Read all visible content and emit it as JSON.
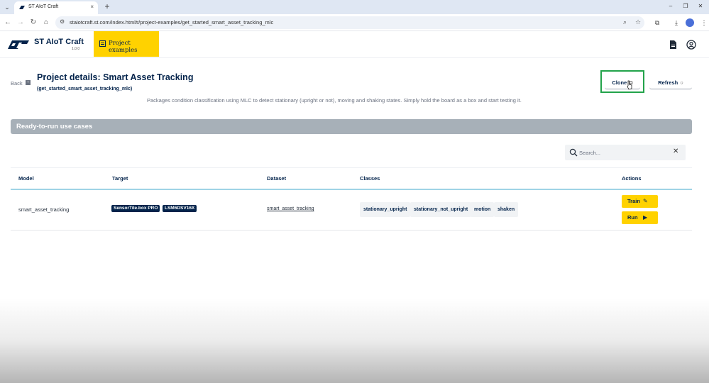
{
  "browser": {
    "tab_title": "ST AIoT Craft",
    "tab_close": "×",
    "new_tab": "+",
    "url": "staiotcraft.st.com/index.html#/project-examples/get_started_smart_asset_tracking_mlc",
    "window_minimize": "–",
    "window_restore": "❐",
    "window_close": "✕"
  },
  "header": {
    "app_name": "ST AIoT Craft",
    "version": "1.0.0",
    "active_tab": "Project examples"
  },
  "project": {
    "back_label": "Back",
    "title": "Project details: Smart Asset Tracking",
    "id": "(get_started_smart_asset_tracking_mlc)",
    "description": "Packages condition classification using MLC to detect stationary (upright or not), moving and shaking states. Simply hold the board as a box and start testing it.",
    "clone_label": "Clone",
    "refresh_label": "Refresh"
  },
  "section": {
    "title": "Ready-to-run use cases"
  },
  "search": {
    "placeholder": "Search..."
  },
  "table": {
    "headers": {
      "model": "Model",
      "target": "Target",
      "dataset": "Dataset",
      "classes": "Classes",
      "actions": "Actions"
    },
    "rows": [
      {
        "model": "smart_asset_tracking",
        "targets": [
          "SensorTile.box PRO",
          "LSM6DSV16X"
        ],
        "dataset": "smart_asset_tracking",
        "classes": [
          "stationary_upright",
          "stationary_not_upright",
          "motion",
          "shaken"
        ],
        "train_label": "Train",
        "run_label": "Run"
      }
    ]
  },
  "colors": {
    "brand_navy": "#03234b",
    "brand_yellow": "#ffd200",
    "section_gray": "#a7b0b8",
    "highlight_green": "#22a34a"
  }
}
